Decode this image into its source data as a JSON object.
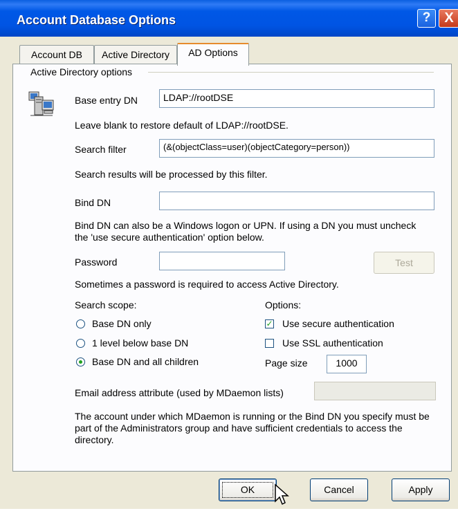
{
  "window": {
    "title": "Account Database Options",
    "help_glyph": "?",
    "close_glyph": "X"
  },
  "tabs": [
    {
      "label": "Account DB"
    },
    {
      "label": "Active Directory"
    },
    {
      "label": "AD Options"
    }
  ],
  "group": {
    "label": "Active Directory options"
  },
  "base_entry": {
    "label": "Base entry DN",
    "value": "LDAP://rootDSE",
    "hint": "Leave blank to restore default of LDAP://rootDSE."
  },
  "search_filter": {
    "label": "Search filter",
    "value": "(&(objectClass=user)(objectCategory=person))",
    "hint": "Search results will be processed by this filter."
  },
  "bind_dn": {
    "label": "Bind DN",
    "value": "",
    "hint": "Bind DN can also be a Windows logon or UPN.  If using a DN you must uncheck the 'use secure authentication' option below."
  },
  "password": {
    "label": "Password",
    "value": "",
    "test_label": "Test",
    "hint": "Sometimes a password is required to access Active Directory."
  },
  "scope": {
    "label": "Search scope:",
    "options": [
      {
        "label": "Base DN only",
        "selected": false
      },
      {
        "label": "1 level below base DN",
        "selected": false
      },
      {
        "label": "Base DN and all children",
        "selected": true
      }
    ]
  },
  "options": {
    "label": "Options:",
    "secure_auth": {
      "label": "Use secure authentication",
      "checked": true
    },
    "ssl_auth": {
      "label": "Use SSL authentication",
      "checked": false
    },
    "page_size": {
      "label": "Page size",
      "value": "1000"
    }
  },
  "email_attr": {
    "label": "Email address attribute (used by MDaemon lists)",
    "value": ""
  },
  "footer_note": "The account under which MDaemon is running or the Bind DN you specify must be part of the Administrators group and have sufficient credentials to access the directory.",
  "buttons": {
    "ok": "OK",
    "cancel": "Cancel",
    "apply": "Apply"
  },
  "colors": {
    "titlebar": "#0054E3",
    "dialog_bg": "#ECE9D8",
    "tab_highlight": "#E68B2C",
    "check_green": "#21A121"
  }
}
